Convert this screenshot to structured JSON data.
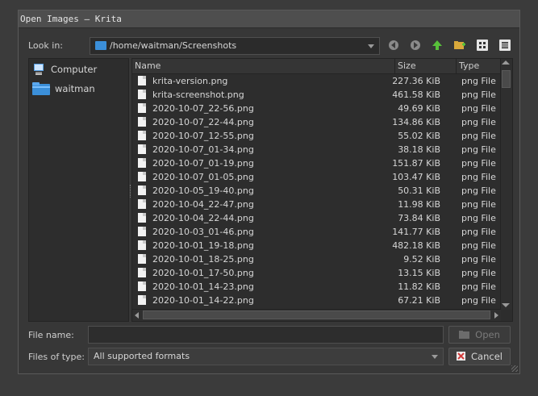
{
  "window": {
    "title": "Open Images — Krita"
  },
  "lookin": {
    "label": "Look in:",
    "path": "/home/waitman/Screenshots"
  },
  "toolbar": {
    "back": "back-arrow",
    "forward": "forward-arrow",
    "up": "parent-directory",
    "new_folder": "create-new-folder",
    "list_view": "list-view",
    "detail_view": "detail-view"
  },
  "sidebar": {
    "items": [
      {
        "label": "Computer",
        "icon": "computer-icon"
      },
      {
        "label": "waitman",
        "icon": "folder-icon"
      }
    ]
  },
  "columns": {
    "name": "Name",
    "size": "Size",
    "type": "Type"
  },
  "files": [
    {
      "name": "krita-version.png",
      "size": "227.36 KiB",
      "type": "png File"
    },
    {
      "name": "krita-screenshot.png",
      "size": "461.58 KiB",
      "type": "png File"
    },
    {
      "name": "2020-10-07_22-56.png",
      "size": "49.69 KiB",
      "type": "png File"
    },
    {
      "name": "2020-10-07_22-44.png",
      "size": "134.86 KiB",
      "type": "png File"
    },
    {
      "name": "2020-10-07_12-55.png",
      "size": "55.02 KiB",
      "type": "png File"
    },
    {
      "name": "2020-10-07_01-34.png",
      "size": "38.18 KiB",
      "type": "png File"
    },
    {
      "name": "2020-10-07_01-19.png",
      "size": "151.87 KiB",
      "type": "png File"
    },
    {
      "name": "2020-10-07_01-05.png",
      "size": "103.47 KiB",
      "type": "png File"
    },
    {
      "name": "2020-10-05_19-40.png",
      "size": "50.31 KiB",
      "type": "png File"
    },
    {
      "name": "2020-10-04_22-47.png",
      "size": "11.98 KiB",
      "type": "png File"
    },
    {
      "name": "2020-10-04_22-44.png",
      "size": "73.84 KiB",
      "type": "png File"
    },
    {
      "name": "2020-10-03_01-46.png",
      "size": "141.77 KiB",
      "type": "png File"
    },
    {
      "name": "2020-10-01_19-18.png",
      "size": "482.18 KiB",
      "type": "png File"
    },
    {
      "name": "2020-10-01_18-25.png",
      "size": "9.52 KiB",
      "type": "png File"
    },
    {
      "name": "2020-10-01_17-50.png",
      "size": "13.15 KiB",
      "type": "png File"
    },
    {
      "name": "2020-10-01_14-23.png",
      "size": "11.82 KiB",
      "type": "png File"
    },
    {
      "name": "2020-10-01_14-22.png",
      "size": "67.21 KiB",
      "type": "png File"
    }
  ],
  "filename": {
    "label": "File name:",
    "value": ""
  },
  "filetype": {
    "label": "Files of type:",
    "value": "All supported formats"
  },
  "buttons": {
    "open": "Open",
    "cancel": "Cancel"
  },
  "colors": {
    "background": "#373737",
    "list_bg": "#2d2d2d",
    "folder": "#3b8fd9",
    "up_arrow": "#58c03a",
    "cancel_x": "#d23a3a"
  }
}
